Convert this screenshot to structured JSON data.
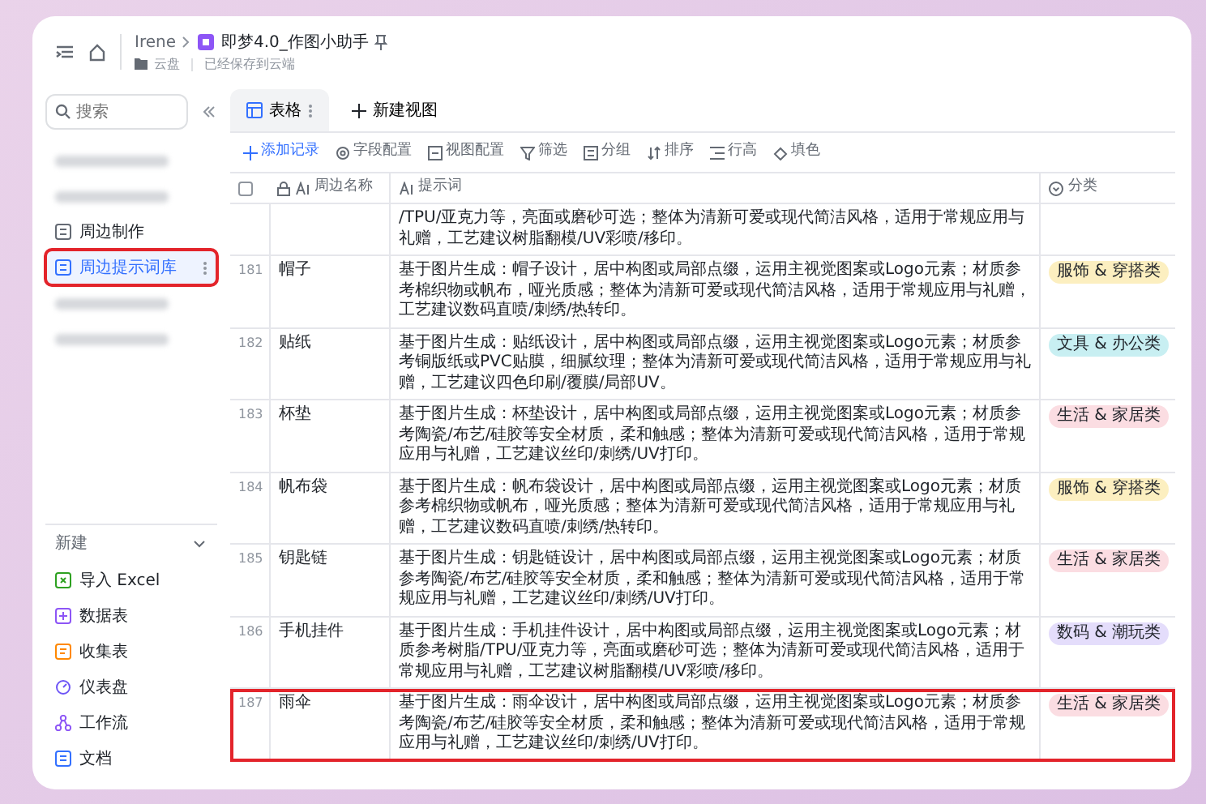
{
  "header": {
    "breadcrumb": [
      "Irene",
      "即梦4.0_作图小助手"
    ],
    "location": "云盘",
    "save_status": "已经保存到云端"
  },
  "sidebar": {
    "search": {
      "placeholder": "搜索"
    },
    "items": [
      {
        "kind": "blurred"
      },
      {
        "kind": "blurred"
      },
      {
        "kind": "item",
        "label": "周边制作",
        "selected": false,
        "highlighted": false
      },
      {
        "kind": "item",
        "label": "周边提示词库",
        "selected": true,
        "highlighted": true
      },
      {
        "kind": "blurred"
      },
      {
        "kind": "blurred"
      }
    ],
    "new_section": {
      "label": "新建",
      "expanded": true,
      "items": [
        {
          "kind": "excel",
          "label": "导入 Excel"
        },
        {
          "kind": "table",
          "label": "数据表"
        },
        {
          "kind": "form",
          "label": "收集表"
        },
        {
          "kind": "dashboard",
          "label": "仪表盘"
        },
        {
          "kind": "workflow",
          "label": "工作流"
        },
        {
          "kind": "doc",
          "label": "文档"
        }
      ]
    }
  },
  "view_tabs": [
    {
      "label": "表格",
      "selected": true
    },
    {
      "label": "新建视图",
      "selected": false
    }
  ],
  "toolbar": [
    {
      "kind": "add",
      "label": "添加记录"
    },
    {
      "kind": "fields",
      "label": "字段配置"
    },
    {
      "kind": "view",
      "label": "视图配置"
    },
    {
      "kind": "filter",
      "label": "筛选"
    },
    {
      "kind": "group",
      "label": "分组"
    },
    {
      "kind": "sort",
      "label": "排序"
    },
    {
      "kind": "height",
      "label": "行高"
    },
    {
      "kind": "fill",
      "label": "填色"
    }
  ],
  "table": {
    "select_all": {
      "checked": false
    },
    "columns": [
      "周边名称",
      "提示词",
      "分类"
    ],
    "partial_row": {
      "prompt": "/TPU/亚克力等，亮面或磨砂可选；整体为清新可爱或现代简洁风格，适用于常规应用与礼赠，工艺建议树脂翻模/UV彩喷/移印。"
    },
    "rows": [
      {
        "number": "181",
        "name": "帽子",
        "prompt": "基于图片生成：帽子设计，居中构图或局部点缀，运用主视觉图案或Logo元素；材质参考棉织物或帆布，哑光质感；整体为清新可爱或现代简洁风格，适用于常规应用与礼赠，工艺建议数码直喷/刺绣/热转印。",
        "category": "服饰 & 穿搭类",
        "color": "#fcefc0",
        "highlighted": false
      },
      {
        "number": "182",
        "name": "贴纸",
        "prompt": "基于图片生成：贴纸设计，居中构图或局部点缀，运用主视觉图案或Logo元素；材质参考铜版纸或PVC贴膜，细腻纹理；整体为清新可爱或现代简洁风格，适用于常规应用与礼赠，工艺建议四色印刷/覆膜/局部UV。",
        "category": "文具 & 办公类",
        "color": "#c8eff2",
        "highlighted": false
      },
      {
        "number": "183",
        "name": "杯垫",
        "prompt": "基于图片生成：杯垫设计，居中构图或局部点缀，运用主视觉图案或Logo元素；材质参考陶瓷/布艺/硅胶等安全材质，柔和触感；整体为清新可爱或现代简洁风格，适用于常规应用与礼赠，工艺建议丝印/刺绣/UV打印。",
        "category": "生活 & 家居类",
        "color": "#fbdde2",
        "highlighted": false
      },
      {
        "number": "184",
        "name": "帆布袋",
        "prompt": "基于图片生成：帆布袋设计，居中构图或局部点缀，运用主视觉图案或Logo元素；材质参考棉织物或帆布，哑光质感；整体为清新可爱或现代简洁风格，适用于常规应用与礼赠，工艺建议数码直喷/刺绣/热转印。",
        "category": "服饰 & 穿搭类",
        "color": "#fcefc0",
        "highlighted": false
      },
      {
        "number": "185",
        "name": "钥匙链",
        "prompt": "基于图片生成：钥匙链设计，居中构图或局部点缀，运用主视觉图案或Logo元素；材质参考陶瓷/布艺/硅胶等安全材质，柔和触感；整体为清新可爱或现代简洁风格，适用于常规应用与礼赠，工艺建议丝印/刺绣/UV打印。",
        "category": "生活 & 家居类",
        "color": "#fbdde2",
        "highlighted": false
      },
      {
        "number": "186",
        "name": "手机挂件",
        "prompt": "基于图片生成：手机挂件设计，居中构图或局部点缀，运用主视觉图案或Logo元素；材质参考树脂/TPU/亚克力等，亮面或磨砂可选；整体为清新可爱或现代简洁风格，适用于常规应用与礼赠，工艺建议树脂翻模/UV彩喷/移印。",
        "category": "数码 & 潮玩类",
        "color": "#e4ddfb",
        "highlighted": false
      },
      {
        "number": "187",
        "name": "雨伞",
        "prompt": "基于图片生成：雨伞设计，居中构图或局部点缀，运用主视觉图案或Logo元素；材质参考陶瓷/布艺/硅胶等安全材质，柔和触感；整体为清新可爱或现代简洁风格，适用于常规应用与礼赠，工艺建议丝印/刺绣/UV打印。",
        "category": "生活 & 家居类",
        "color": "#fbdde2",
        "highlighted": true
      }
    ]
  }
}
